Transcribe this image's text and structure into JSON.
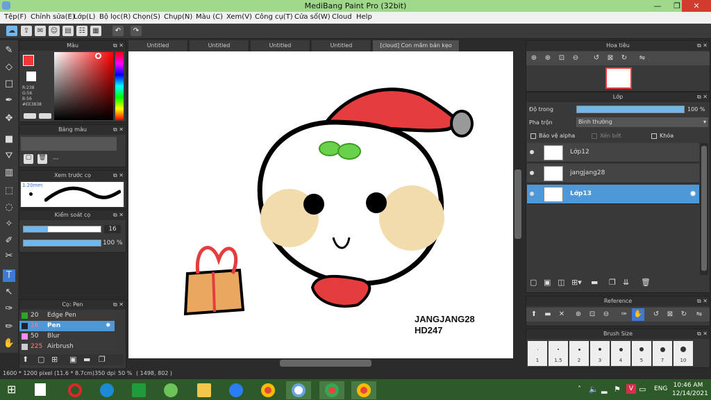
{
  "app": {
    "title": "MediBang Paint Pro (32bit)"
  },
  "menu": [
    "Tệp(F)",
    "Chỉnh sửa(E)",
    "Lớp(L)",
    "Bộ lọc(R)",
    "Chọn(S)",
    "Chụp(N)",
    "Màu (C)",
    "Xem(V)",
    "Công cụ(T)",
    "Cửa sổ(W)",
    "Cloud",
    "Help"
  ],
  "tabs": [
    "Untitled",
    "Untitled",
    "Untitled",
    "Untitled",
    "[cloud] Con mầm bán kẹo lạc:r1+"
  ],
  "color_panel": {
    "title": "Màu",
    "r": "R:238",
    "g": "G:56",
    "b": "B:56",
    "hex": "#EE3838",
    "primary": "#EE3838"
  },
  "palette_panel": {
    "title": "Bảng màu",
    "text": "---"
  },
  "brush_preview": {
    "title": "Xem trước cọ",
    "size": "1.20mm"
  },
  "brush_control": {
    "title": "Kiểm soát cọ",
    "size_value": "16",
    "opacity_value": "100",
    "opacity_unit": "%"
  },
  "brush_list": {
    "title": "Cọ: Pen",
    "items": [
      {
        "size": "20",
        "name": "Edge Pen",
        "swatch": "#22aa22"
      },
      {
        "size": "16",
        "name": "Pen",
        "swatch": "#222222"
      },
      {
        "size": "50",
        "name": "Blur",
        "swatch": "#ff88ff"
      },
      {
        "size": "225",
        "name": "Airbrush",
        "swatch": "#cccccc"
      }
    ]
  },
  "navigator": {
    "title": "Hoa tiêu"
  },
  "layer_panel": {
    "title": "Lớp",
    "opacity_label": "Độ trong",
    "opacity_value": "100 %",
    "blend_label": "Pha trộn",
    "blend_value": "Bình thường",
    "protect_alpha": "Bảo vệ alpha",
    "clipping": "Xén bớt",
    "lock": "Khóa",
    "layers": [
      {
        "name": "Lớp12"
      },
      {
        "name": "jangjang28"
      },
      {
        "name": "Lớp13"
      }
    ]
  },
  "reference": {
    "title": "Reference"
  },
  "brush_size": {
    "title": "Brush Size",
    "sizes": [
      "1",
      "1.5",
      "2",
      "3",
      "4",
      "5",
      "7",
      "10"
    ]
  },
  "canvas_text": {
    "line1": "JANGJANG28",
    "line2": "HD247"
  },
  "status": {
    "dims": "1600 * 1200 pixel",
    "physical": "(11.6 * 8.7cm)",
    "dpi": "350 dpi",
    "zoom": "50 %",
    "coords": "( 1498, 802 )"
  },
  "taskbar": {
    "lang": "ENG",
    "time": "10:46 AM",
    "date": "12/14/2021"
  }
}
